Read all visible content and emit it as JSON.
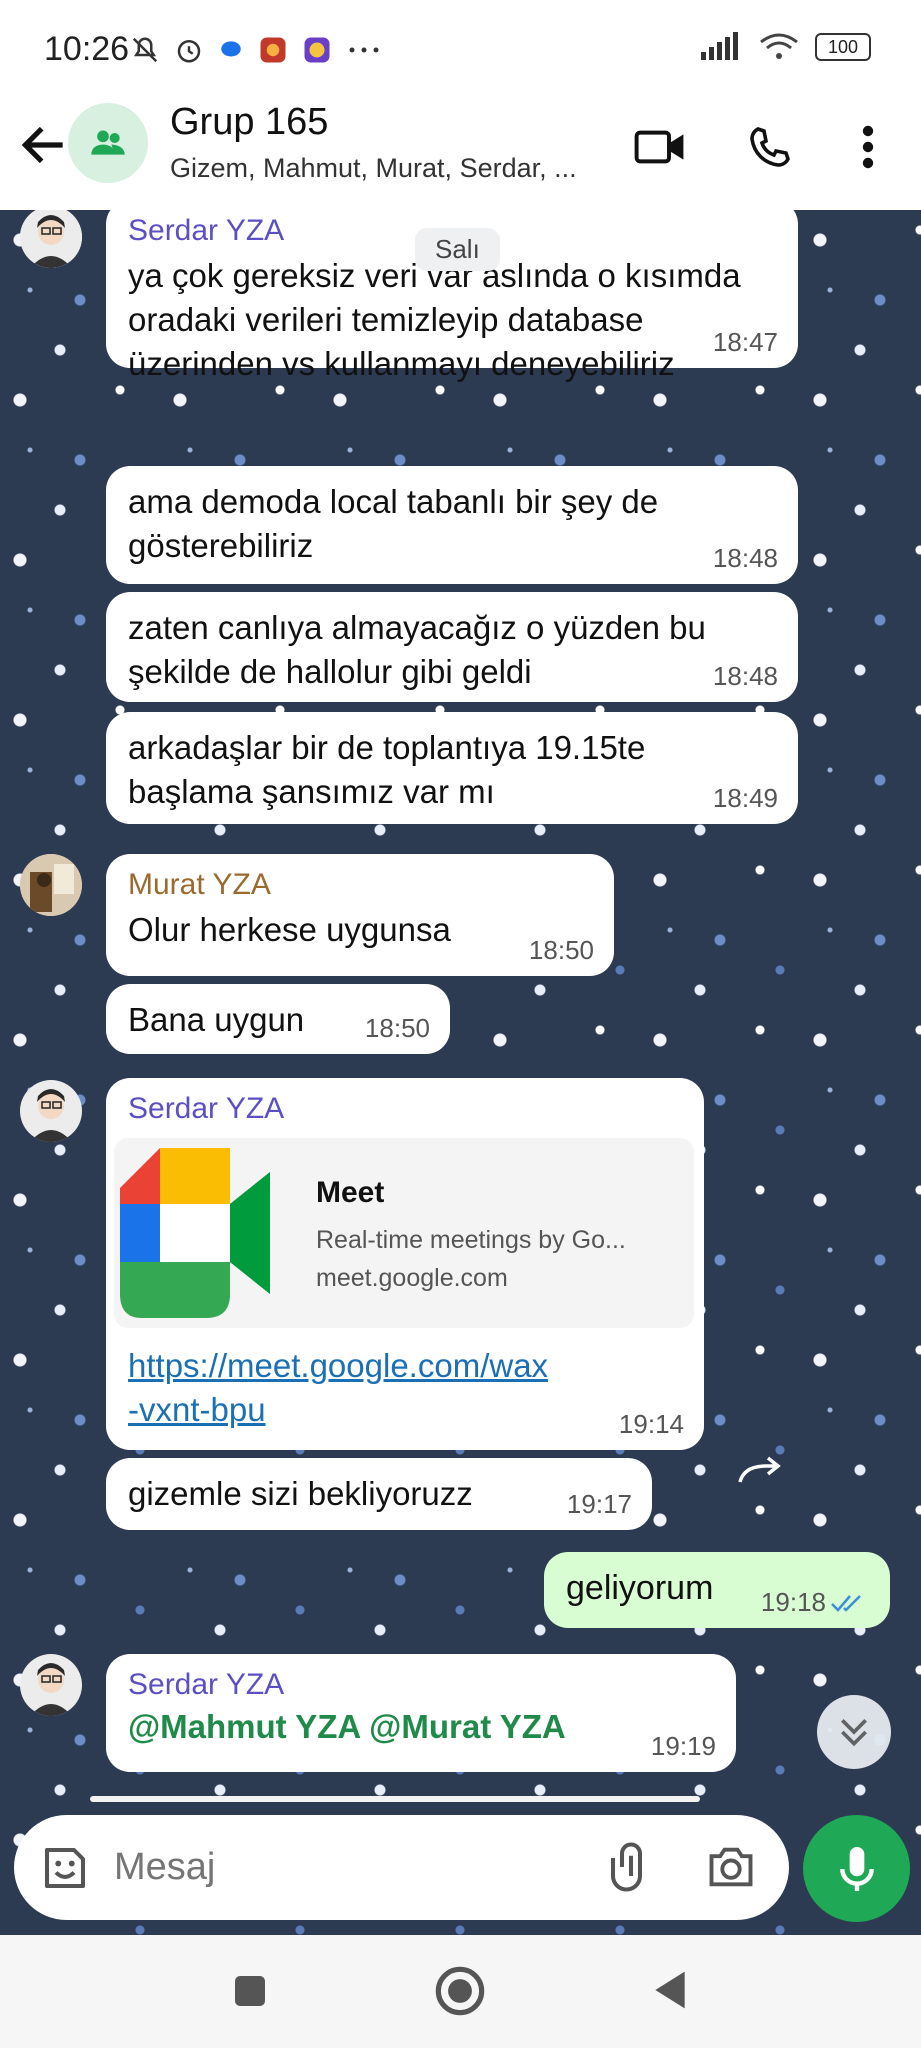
{
  "status_bar": {
    "time": "10:26",
    "battery": "100"
  },
  "header": {
    "title": "Grup 165",
    "subtitle": "Gizem, Mahmut, Murat, Serdar, ..."
  },
  "date_separator": "Salı",
  "messages": [
    {
      "sender": "Serdar YZA",
      "text": "ya çok gereksiz veri var aslında o kısımda oradaki verileri temizleyip database üzerinden vs kullanmayı deneyebiliriz",
      "time": "18:47"
    },
    {
      "text": "ama demoda local tabanlı bir şey de gösterebiliriz",
      "time": "18:48"
    },
    {
      "text": "zaten canlıya almayacağız o yüzden bu şekilde de hallolur gibi geldi",
      "time": "18:48"
    },
    {
      "text": "arkadaşlar bir de toplantıya 19.15te başlama şansımız var mı",
      "time": "18:49"
    },
    {
      "sender": "Murat YZA",
      "text": "Olur herkese uygunsa",
      "time": "18:50"
    },
    {
      "text": "Bana uygun",
      "time": "18:50"
    },
    {
      "sender": "Serdar YZA",
      "preview_title": "Meet",
      "preview_desc": "Real-time meetings by Go...",
      "preview_domain": "meet.google.com",
      "link_line1": "https://meet.google.com/wax",
      "link_line2": "-vxnt-bpu",
      "time": "19:14"
    },
    {
      "text": "gizemle sizi bekliyoruzz",
      "time": "19:17"
    },
    {
      "text": "geliyorum",
      "time": "19:18",
      "outgoing": true
    },
    {
      "sender": "Serdar YZA",
      "mention": "@Mahmut YZA @Murat YZA",
      "time": "19:19"
    }
  ],
  "composer": {
    "placeholder": "Mesaj"
  },
  "colors": {
    "serdar": "#5b4fc4",
    "murat": "#9a6a2f",
    "accent": "#1fa855",
    "outgoing_bubble": "#d9fdd3"
  }
}
